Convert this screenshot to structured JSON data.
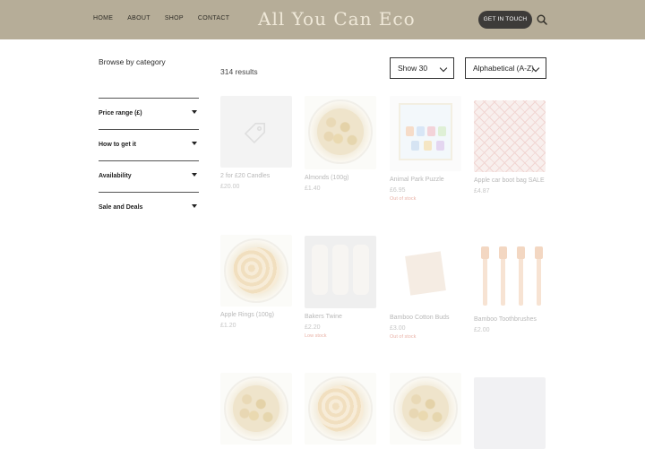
{
  "header": {
    "nav": [
      "HOME",
      "ABOUT",
      "SHOP",
      "CONTACT"
    ],
    "logo": "All You Can Eco",
    "cta": "GET IN TOUCH",
    "icons": {
      "search": "search-icon"
    },
    "colors": {
      "bar": "#b6ad98",
      "cta": "#3d3b39"
    }
  },
  "sidebar": {
    "heading": "Browse by category",
    "filters": [
      "Price range (£)",
      "How to get it",
      "Availability",
      "Sale and Deals"
    ]
  },
  "toolbar": {
    "results": "314 results",
    "show": "Show 30",
    "sort": "Alphabetical (A-Z)"
  },
  "products": [
    {
      "name": "2 for £20 Candles",
      "price": "£20.00",
      "stock": ""
    },
    {
      "name": "Almonds (100g)",
      "price": "£1.40",
      "stock": ""
    },
    {
      "name": "Animal Park Puzzle",
      "price": "£6.95",
      "stock": "Out of stock"
    },
    {
      "name": "Apple car boot bag SALE",
      "price": "£4.87",
      "stock": ""
    },
    {
      "name": "Apple Rings (100g)",
      "price": "£1.20",
      "stock": ""
    },
    {
      "name": "Bakers Twine",
      "price": "£2.20",
      "stock": "Low stock"
    },
    {
      "name": "Bamboo Cotton Buds",
      "price": "£3.00",
      "stock": "Out of stock"
    },
    {
      "name": "Bamboo Toothbrushes",
      "price": "£2.00",
      "stock": ""
    }
  ]
}
